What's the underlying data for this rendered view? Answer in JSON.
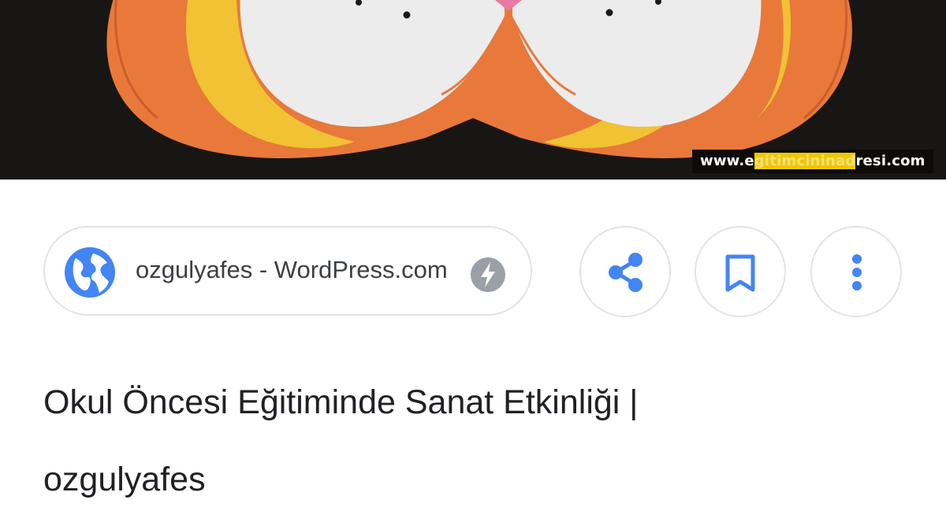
{
  "image": {
    "watermark": {
      "prefix": "www.e",
      "highlight": "gitimcininad",
      "suffix": "resi.com"
    }
  },
  "source": {
    "icon": "globe-icon",
    "label": "ozgulyafes - WordPress.com",
    "badge_icon": "amp-lightning-icon"
  },
  "actions": [
    {
      "icon": "share-icon"
    },
    {
      "icon": "bookmark-icon"
    },
    {
      "icon": "more-vert-icon"
    }
  ],
  "title": {
    "line1": "Okul Öncesi Eğitiminde Sanat Etkinliği |",
    "line2": "ozgulyafes"
  },
  "colors": {
    "accent_blue": "#4285f4",
    "badge_gray": "#9aa0a6",
    "text": "#202124"
  }
}
